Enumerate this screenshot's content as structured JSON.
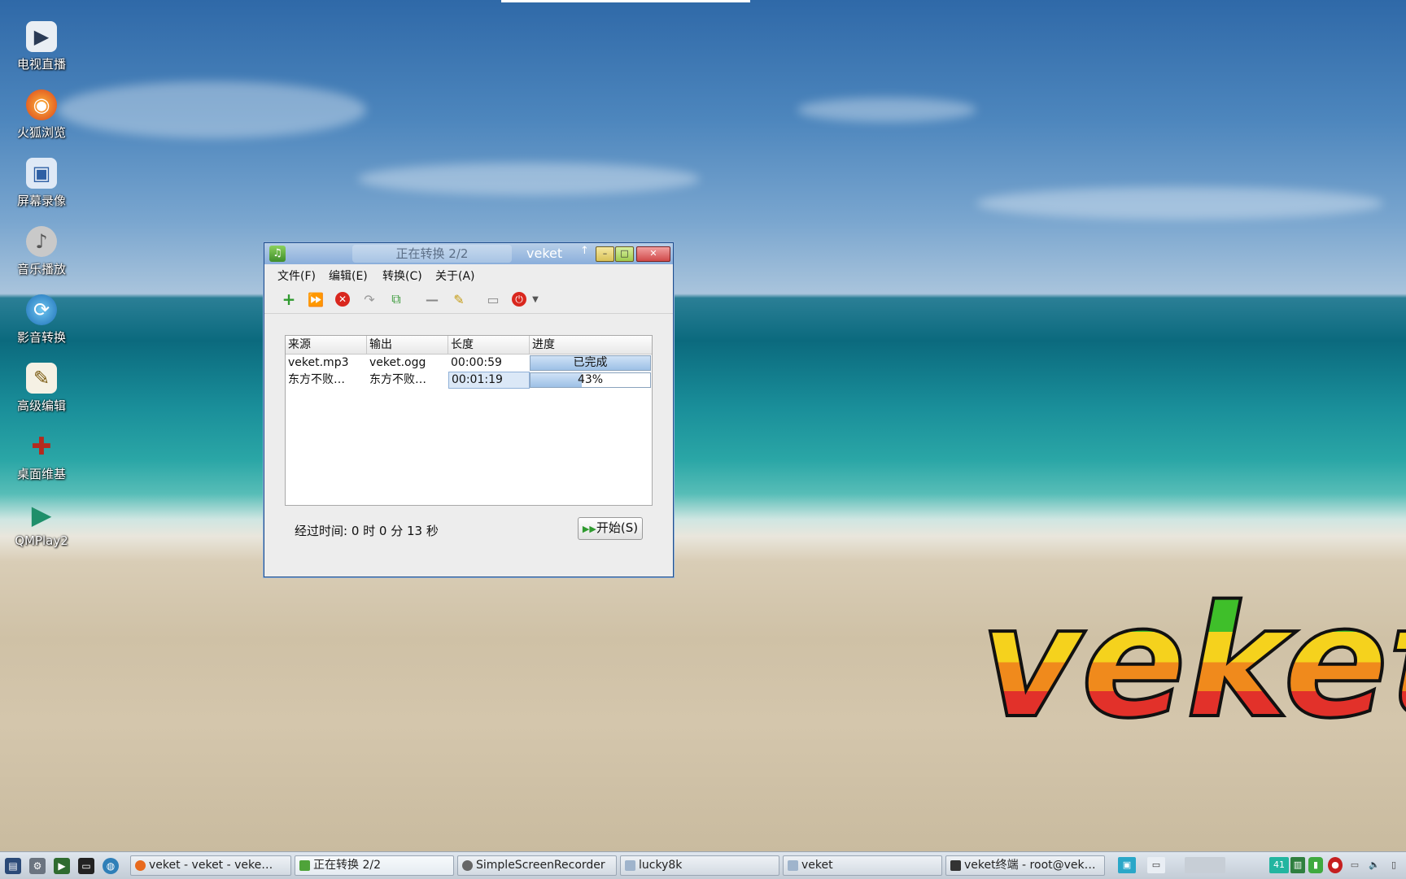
{
  "desktop_icons": [
    {
      "label": "电视直播",
      "icon": "tv-icon"
    },
    {
      "label": "火狐浏览",
      "icon": "firefox-icon"
    },
    {
      "label": "屏幕录像",
      "icon": "screen-recorder-icon"
    },
    {
      "label": "音乐播放",
      "icon": "speaker-icon"
    },
    {
      "label": "影音转换",
      "icon": "media-convert-icon"
    },
    {
      "label": "高级编辑",
      "icon": "text-editor-icon"
    },
    {
      "label": "桌面维基",
      "icon": "wiki-icon"
    },
    {
      "label": "QMPlay2",
      "icon": "play-icon"
    }
  ],
  "logo_text": "veket",
  "window": {
    "tab_title": "正在转换 2/2",
    "title": "veket",
    "menu": [
      "文件(F)",
      "编辑(E)",
      "转换(C)",
      "关于(A)"
    ],
    "table": {
      "columns": [
        "来源",
        "输出",
        "长度",
        "进度"
      ],
      "rows": [
        {
          "source": "veket.mp3",
          "output": "veket.ogg",
          "length": "00:00:59",
          "progress_text": "已完成",
          "progress": 100
        },
        {
          "source": "东方不败…",
          "output": "东方不败…",
          "length": "00:01:19",
          "progress_text": "43%",
          "progress": 43
        }
      ]
    },
    "elapsed": "经过时间: 0 时 0 分 13 秒",
    "start_label": "开始(S)"
  },
  "taskbar": {
    "tasks": [
      {
        "label": "veket - veket - veke…",
        "icon": "firefox-icon"
      },
      {
        "label": "正在转换 2/2",
        "icon": "music-app-icon"
      },
      {
        "label": "SimpleScreenRecorder",
        "icon": "recorder-icon"
      },
      {
        "label": "lucky8k",
        "icon": "folder-icon"
      },
      {
        "label": "veket",
        "icon": "folder-icon"
      },
      {
        "label": "veket终端 - root@vek…",
        "icon": "terminal-icon"
      }
    ],
    "cpu_value": "41"
  },
  "colors": {
    "accent": "#1f4e8c",
    "progress_fill": "#9dc0e6",
    "titlebar": "#8aaedb"
  }
}
